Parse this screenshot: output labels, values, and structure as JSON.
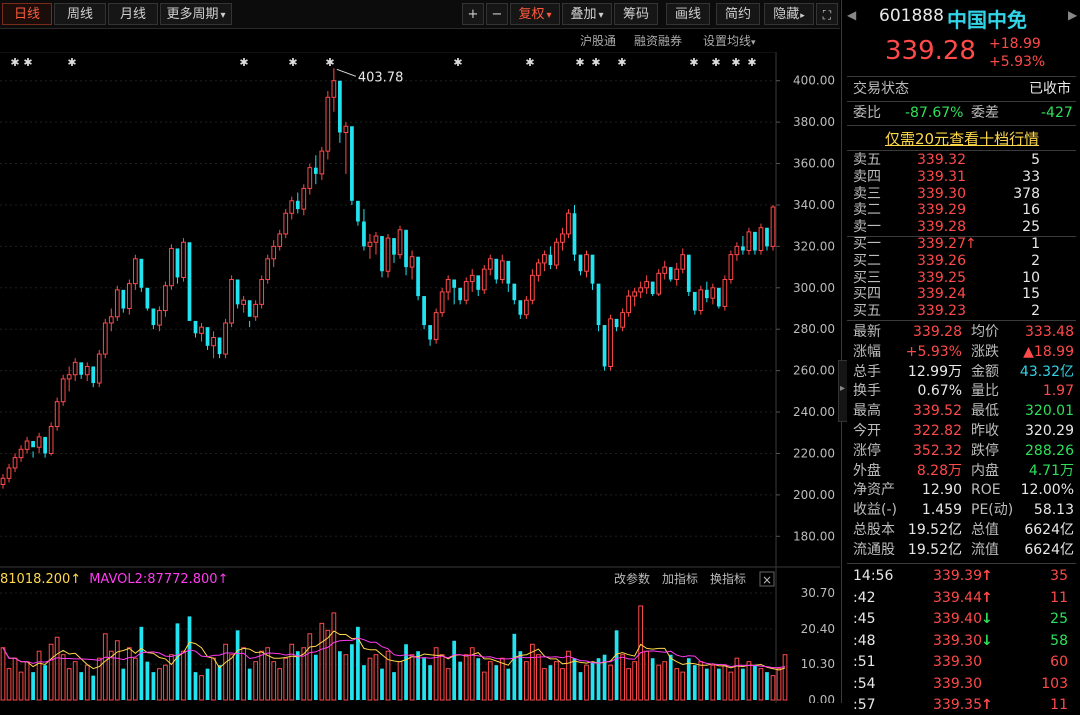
{
  "toolbar": {
    "tabs": [
      "日线",
      "周线",
      "月线",
      "更多周期"
    ],
    "plus": "+",
    "minus": "−",
    "buttons": [
      "复权",
      "叠加",
      "筹码",
      "画线",
      "简约",
      "隐藏"
    ],
    "dropdown_mark": "▾"
  },
  "subbar": {
    "items": [
      "沪股通",
      "融资融券",
      "设置均线"
    ]
  },
  "chart": {
    "peak_label": "403.78",
    "yticks": [
      "400.00",
      "380.00",
      "360.00",
      "340.00",
      "320.00",
      "300.00",
      "280.00",
      "260.00",
      "240.00",
      "220.00",
      "200.00",
      "180.00"
    ],
    "vol_legend_a": "81018.200",
    "vol_legend_b": "MAVOL2:87772.800",
    "vol_arrow": "↑",
    "vol_buttons": [
      "改参数",
      "加指标",
      "换指标"
    ],
    "vol_close": "×",
    "vol_ticks": [
      "30.70",
      "20.40",
      "10.30",
      "0.00"
    ],
    "colors": {
      "up": "#ff4a4a",
      "down": "#22e3f0",
      "ma1": "#ffd84a",
      "ma2": "#ff3cf0"
    }
  },
  "chart_data": {
    "type": "candlestick",
    "ylim": [
      170,
      410
    ],
    "candles": [
      [
        205,
        210,
        203,
        208
      ],
      [
        208,
        215,
        206,
        213
      ],
      [
        213,
        220,
        211,
        218
      ],
      [
        218,
        224,
        216,
        222
      ],
      [
        222,
        228,
        220,
        226
      ],
      [
        226,
        221,
        218,
        223
      ],
      [
        223,
        230,
        220,
        228
      ],
      [
        228,
        226,
        218,
        220
      ],
      [
        220,
        235,
        219,
        233
      ],
      [
        233,
        247,
        231,
        245
      ],
      [
        245,
        258,
        243,
        256
      ],
      [
        256,
        262,
        250,
        258
      ],
      [
        258,
        266,
        255,
        264
      ],
      [
        264,
        260,
        256,
        258
      ],
      [
        258,
        264,
        255,
        262
      ],
      [
        262,
        255,
        252,
        254
      ],
      [
        254,
        270,
        252,
        268
      ],
      [
        268,
        285,
        266,
        283
      ],
      [
        283,
        290,
        279,
        286
      ],
      [
        286,
        301,
        284,
        299
      ],
      [
        299,
        296,
        288,
        290
      ],
      [
        290,
        304,
        287,
        302
      ],
      [
        302,
        316,
        299,
        314
      ],
      [
        314,
        309,
        298,
        300
      ],
      [
        300,
        292,
        289,
        290
      ],
      [
        290,
        286,
        280,
        282
      ],
      [
        282,
        291,
        279,
        289
      ],
      [
        289,
        303,
        286,
        301
      ],
      [
        301,
        321,
        299,
        319
      ],
      [
        319,
        313,
        302,
        305
      ],
      [
        305,
        324,
        303,
        322
      ],
      [
        322,
        301,
        285,
        284
      ],
      [
        284,
        280,
        276,
        278
      ],
      [
        278,
        283,
        274,
        281
      ],
      [
        281,
        274,
        270,
        272
      ],
      [
        272,
        279,
        266,
        276
      ],
      [
        276,
        271,
        266,
        268
      ],
      [
        268,
        285,
        266,
        283
      ],
      [
        283,
        306,
        281,
        304
      ],
      [
        304,
        300,
        290,
        292
      ],
      [
        292,
        296,
        288,
        294
      ],
      [
        294,
        284,
        281,
        286
      ],
      [
        286,
        294,
        284,
        292
      ],
      [
        292,
        306,
        290,
        304
      ],
      [
        304,
        316,
        302,
        314
      ],
      [
        314,
        323,
        310,
        320
      ],
      [
        320,
        328,
        318,
        326
      ],
      [
        326,
        338,
        324,
        336
      ],
      [
        336,
        344,
        333,
        342
      ],
      [
        342,
        346,
        336,
        338
      ],
      [
        338,
        350,
        335,
        348
      ],
      [
        348,
        360,
        345,
        358
      ],
      [
        358,
        364,
        350,
        355
      ],
      [
        355,
        368,
        352,
        366
      ],
      [
        366,
        395,
        362,
        392
      ],
      [
        392,
        406,
        385,
        400
      ],
      [
        400,
        392,
        370,
        375
      ],
      [
        375,
        380,
        355,
        378
      ],
      [
        378,
        345,
        340,
        342
      ],
      [
        342,
        335,
        330,
        332
      ],
      [
        332,
        338,
        318,
        320
      ],
      [
        320,
        326,
        314,
        322
      ],
      [
        322,
        327,
        316,
        325
      ],
      [
        325,
        320,
        305,
        308
      ],
      [
        308,
        326,
        305,
        324
      ],
      [
        324,
        318,
        312,
        316
      ],
      [
        316,
        330,
        314,
        328
      ],
      [
        328,
        315,
        306,
        310
      ],
      [
        310,
        318,
        304,
        315
      ],
      [
        315,
        298,
        294,
        296
      ],
      [
        296,
        284,
        280,
        282
      ],
      [
        282,
        277,
        272,
        275
      ],
      [
        275,
        290,
        273,
        288
      ],
      [
        288,
        300,
        286,
        298
      ],
      [
        298,
        306,
        294,
        304
      ],
      [
        304,
        302,
        292,
        300
      ],
      [
        300,
        296,
        292,
        294
      ],
      [
        294,
        305,
        292,
        303
      ],
      [
        303,
        309,
        298,
        306
      ],
      [
        306,
        301,
        296,
        299
      ],
      [
        299,
        311,
        297,
        309
      ],
      [
        309,
        316,
        306,
        314
      ],
      [
        314,
        307,
        302,
        304
      ],
      [
        304,
        316,
        302,
        313
      ],
      [
        313,
        304,
        298,
        302
      ],
      [
        302,
        298,
        292,
        294
      ],
      [
        294,
        288,
        285,
        287
      ],
      [
        287,
        296,
        285,
        294
      ],
      [
        294,
        309,
        292,
        306
      ],
      [
        306,
        314,
        303,
        312
      ],
      [
        312,
        318,
        308,
        316
      ],
      [
        316,
        320,
        309,
        311
      ],
      [
        311,
        324,
        309,
        322
      ],
      [
        322,
        329,
        318,
        326
      ],
      [
        326,
        338,
        324,
        336
      ],
      [
        336,
        340,
        313,
        316
      ],
      [
        316,
        311,
        306,
        308
      ],
      [
        308,
        318,
        305,
        316
      ],
      [
        316,
        312,
        299,
        302
      ],
      [
        302,
        290,
        279,
        282
      ],
      [
        282,
        270,
        260,
        262
      ],
      [
        262,
        287,
        260,
        285
      ],
      [
        285,
        283,
        279,
        281
      ],
      [
        281,
        290,
        279,
        288
      ],
      [
        288,
        299,
        286,
        296
      ],
      [
        296,
        300,
        291,
        298
      ],
      [
        298,
        303,
        295,
        300
      ],
      [
        300,
        306,
        297,
        303
      ],
      [
        303,
        300,
        296,
        297
      ],
      [
        297,
        309,
        296,
        307
      ],
      [
        307,
        313,
        304,
        310
      ],
      [
        310,
        305,
        303,
        304
      ],
      [
        304,
        312,
        301,
        309
      ],
      [
        309,
        319,
        307,
        316
      ],
      [
        316,
        302,
        296,
        298
      ],
      [
        298,
        291,
        287,
        289
      ],
      [
        289,
        301,
        287,
        299
      ],
      [
        299,
        303,
        293,
        295
      ],
      [
        295,
        302,
        292,
        300
      ],
      [
        300,
        296,
        290,
        291
      ],
      [
        291,
        306,
        289,
        304
      ],
      [
        304,
        318,
        302,
        316
      ],
      [
        316,
        322,
        313,
        320
      ],
      [
        320,
        325,
        316,
        318
      ],
      [
        318,
        329,
        316,
        327
      ],
      [
        327,
        322,
        316,
        318
      ],
      [
        318,
        331,
        316,
        329
      ],
      [
        329,
        326,
        318,
        320
      ],
      [
        320,
        340,
        318,
        339
      ]
    ],
    "volumes": [
      15,
      9,
      12,
      8,
      11,
      8,
      14,
      10,
      16,
      18,
      13,
      9,
      11,
      8,
      10,
      7,
      12,
      19,
      14,
      17,
      9,
      15,
      12,
      21,
      11,
      8,
      9,
      10,
      13,
      22,
      14,
      24,
      8,
      7,
      9,
      12,
      10,
      16,
      13,
      20,
      15,
      9,
      11,
      14,
      15,
      11,
      9,
      12,
      16,
      14,
      15,
      19,
      13,
      22,
      20,
      25,
      14,
      13,
      16,
      21,
      10,
      12,
      13,
      9,
      14,
      8,
      11,
      16,
      13,
      14,
      12,
      10,
      15,
      13,
      9,
      17,
      11,
      13,
      15,
      12,
      8,
      11,
      10,
      12,
      9,
      19,
      14,
      11,
      16,
      13,
      9,
      10,
      11,
      9,
      14,
      12,
      8,
      10,
      11,
      12,
      13,
      10,
      20,
      13,
      9,
      11,
      27,
      14,
      12,
      10,
      11,
      13,
      9,
      8,
      12,
      10,
      11,
      9,
      10,
      9,
      10,
      8,
      12,
      9,
      11,
      10,
      9,
      8,
      7,
      9,
      13
    ]
  },
  "panel": {
    "code": "601888",
    "name": "中国中免",
    "price": "339.28",
    "change": "+18.99",
    "change_pct": "+5.93%",
    "status_label": "交易状态",
    "status_value": "已收市",
    "ratio_label": "委比",
    "ratio_value": "-87.67%",
    "diff_label": "委差",
    "diff_value": "-427",
    "promo": "仅需20元查看十档行情",
    "asks": [
      {
        "label": "卖五",
        "price": "339.32",
        "vol": "5"
      },
      {
        "label": "卖四",
        "price": "339.31",
        "vol": "33"
      },
      {
        "label": "卖三",
        "price": "339.30",
        "vol": "378"
      },
      {
        "label": "卖二",
        "price": "339.29",
        "vol": "16"
      },
      {
        "label": "卖一",
        "price": "339.28",
        "vol": "25"
      }
    ],
    "bids": [
      {
        "label": "买一",
        "price": "339.27",
        "arrow": "↑",
        "vol": "1"
      },
      {
        "label": "买二",
        "price": "339.26",
        "arrow": "",
        "vol": "2"
      },
      {
        "label": "买三",
        "price": "339.25",
        "arrow": "",
        "vol": "10"
      },
      {
        "label": "买四",
        "price": "339.24",
        "arrow": "",
        "vol": "15"
      },
      {
        "label": "买五",
        "price": "339.23",
        "arrow": "",
        "vol": "2"
      }
    ],
    "stats": [
      {
        "l1": "最新",
        "v1": "339.28",
        "c1": "rd",
        "l2": "均价",
        "v2": "333.48",
        "c2": "rd"
      },
      {
        "l1": "涨幅",
        "v1": "+5.93%",
        "c1": "rd",
        "l2": "涨跌",
        "v2": "▲18.99",
        "c2": "rd"
      },
      {
        "l1": "总手",
        "v1": "12.99万",
        "c1": "wh",
        "l2": "金额",
        "v2": "43.32亿",
        "c2": "cy"
      },
      {
        "l1": "换手",
        "v1": "0.67%",
        "c1": "wh",
        "l2": "量比",
        "v2": "1.97",
        "c2": "rd"
      },
      {
        "l1": "最高",
        "v1": "339.52",
        "c1": "rd",
        "l2": "最低",
        "v2": "320.01",
        "c2": "gr"
      },
      {
        "l1": "今开",
        "v1": "322.82",
        "c1": "rd",
        "l2": "昨收",
        "v2": "320.29",
        "c2": "wh"
      },
      {
        "l1": "涨停",
        "v1": "352.32",
        "c1": "rd",
        "l2": "跌停",
        "v2": "288.26",
        "c2": "gr"
      },
      {
        "l1": "外盘",
        "v1": "8.28万",
        "c1": "rd",
        "l2": "内盘",
        "v2": "4.71万",
        "c2": "gr"
      },
      {
        "l1": "净资产",
        "v1": "12.90",
        "c1": "wh",
        "l2": "ROE",
        "v2": "12.00%",
        "c2": "wh"
      },
      {
        "l1": "收益(-)",
        "v1": "1.459",
        "c1": "wh",
        "l2": "PE(动)",
        "v2": "58.13",
        "c2": "wh"
      },
      {
        "l1": "总股本",
        "v1": "19.52亿",
        "c1": "wh",
        "l2": "总值",
        "v2": "6624亿",
        "c2": "wh"
      },
      {
        "l1": "流通股",
        "v1": "19.52亿",
        "c1": "wh",
        "l2": "流值",
        "v2": "6624亿",
        "c2": "wh"
      }
    ],
    "ticks": [
      {
        "time": "14:56",
        "price": "339.39",
        "arrow": "↑",
        "ac": "rd",
        "vol": "35",
        "vc": "rd"
      },
      {
        "time": ":42",
        "price": "339.44",
        "arrow": "↑",
        "ac": "rd",
        "vol": "11",
        "vc": "rd"
      },
      {
        "time": ":45",
        "price": "339.40",
        "arrow": "↓",
        "ac": "gr",
        "vol": "25",
        "vc": "gr"
      },
      {
        "time": ":48",
        "price": "339.30",
        "arrow": "↓",
        "ac": "gr",
        "vol": "58",
        "vc": "gr"
      },
      {
        "time": ":51",
        "price": "339.30",
        "arrow": "",
        "ac": "rd",
        "vol": "60",
        "vc": "rd"
      },
      {
        "time": ":54",
        "price": "339.30",
        "arrow": "",
        "ac": "rd",
        "vol": "103",
        "vc": "rd"
      },
      {
        "time": ":57",
        "price": "339.35",
        "arrow": "↑",
        "ac": "rd",
        "vol": "11",
        "vc": "rd"
      }
    ]
  }
}
